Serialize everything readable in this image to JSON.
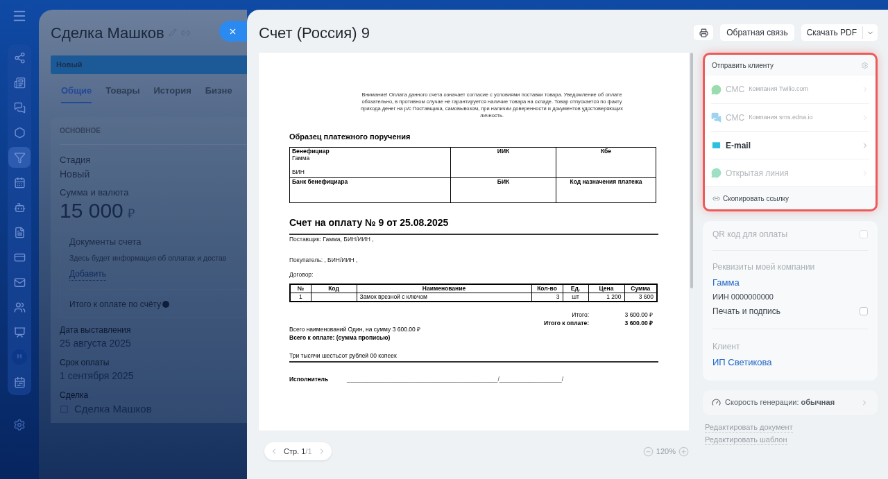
{
  "sidebar": {
    "items": [
      {
        "kind": "icon",
        "selected": false
      },
      {
        "kind": "icon",
        "selected": false
      },
      {
        "kind": "icon",
        "selected": false
      },
      {
        "kind": "icon",
        "selected": false
      },
      {
        "kind": "icon",
        "selected": true
      },
      {
        "kind": "icon",
        "selected": false
      },
      {
        "kind": "icon",
        "selected": false
      },
      {
        "kind": "icon",
        "selected": false
      },
      {
        "kind": "icon",
        "selected": false
      },
      {
        "kind": "icon",
        "selected": false
      },
      {
        "kind": "icon",
        "selected": false
      },
      {
        "kind": "icon",
        "selected": false
      },
      {
        "kind": "avatar",
        "label": "Н",
        "selected": false
      },
      {
        "kind": "icon",
        "selected": false
      }
    ]
  },
  "deal": {
    "title": "Сделка Машков",
    "stage": "Новый",
    "tabs": [
      {
        "label": "Общие",
        "selected": true
      },
      {
        "label": "Товары",
        "selected": false
      },
      {
        "label": "История",
        "selected": false
      },
      {
        "label": "Бизне",
        "selected": false
      }
    ],
    "section": "ОСНОВНОЕ",
    "stage_label": "Стадия",
    "stage_value": "Новый",
    "amount_label": "Сумма и валюта",
    "amount": "15 000",
    "currency": "₽",
    "documents": {
      "title": "Документы счета",
      "text": "Здесь будет информация об оплатах и достав",
      "add": "Добавить",
      "total": "Итого к оплате по счёту"
    },
    "fields": [
      {
        "label": "Дата выставления",
        "value": "25 августа 2025"
      },
      {
        "label": "Срок оплаты",
        "value": "1 сентября 2025"
      }
    ],
    "link_label": "Сделка",
    "link_value": "Сделка Машков"
  },
  "slider": {
    "title": "Счет (Россия) 9",
    "buttons": [
      "Обратная связь"
    ],
    "download": "Скачать PDF"
  },
  "document": {
    "notice": "Внимание! Оплата данного счета означает  согласие  с условиями  поставки товара. Уведомление об оплате обязательно,   в противном   случае не гарантируется наличие товара на складе. Товар отпускается по факту прихода денег на р/с Поставщика, самовывозом, при наличии доверенности и документов удостоверяющих личность.",
    "order_title": "Образец платежного поручения",
    "order_rows": [
      [
        {
          "head": "Бенефициар",
          "lines": [
            "Гамма",
            "БИН"
          ]
        },
        {
          "head": "ИИК"
        },
        {
          "head": "Кбе"
        }
      ],
      [
        {
          "head": "Банк бенефициара"
        },
        {
          "head": "БИК"
        },
        {
          "head": "Код назначения платежа"
        }
      ]
    ],
    "invoice_title": "Счет на оплату № 9 от 25.08.2025",
    "supplier": "Поставщик: Гамма, БИН/ИИН ,",
    "buyer": "Покупатель: , БИН/ИИН ,",
    "contract": "Договор:",
    "columns": [
      "№",
      "Код",
      "Наименование",
      "Кол-во",
      "Ед.",
      "Цена",
      "Сумма"
    ],
    "rows": [
      [
        "1",
        "",
        "Замок врезной с ключом",
        "3",
        "шт",
        "1 200",
        "3 600"
      ]
    ],
    "totals": [
      {
        "label": "Итого:",
        "value": "3 600.00 ₽",
        "bold": false
      },
      {
        "label": "Итого к оплате:",
        "value": "3 600.00 ₽",
        "bold": true
      }
    ],
    "count_line": "Всего наименований Один, на сумму 3 600.00 ₽",
    "words_title": "Всего к оплате: (сумма прописью)",
    "words": "Три тысячи шестьсот рублей 00 копеек",
    "signer": "Исполнитель",
    "sign_line": "______________________________________________/___________________/"
  },
  "pager": {
    "page": "Стр. 1",
    "total": "/1",
    "zoom": "120%"
  },
  "send_panel": {
    "title": "Отправить клиенту",
    "highlighted": true,
    "channels": [
      {
        "name": "СМС",
        "provider": "Компания Twilio.com",
        "disabled": true
      },
      {
        "name": "СМС",
        "provider": "Компания sms.edna.io",
        "disabled": true
      },
      {
        "name": "E-mail",
        "disabled": false
      },
      {
        "name": "Открытая линия",
        "disabled": true
      }
    ],
    "copy_link": "Скопировать ссылку"
  },
  "options": {
    "qr": {
      "label": "QR код для оплаты",
      "checked": false,
      "disabled": true
    },
    "company_label": "Реквизиты моей компании",
    "company": "Гамма",
    "company_id": "ИИН 0000000000",
    "stamp": {
      "label": "Печать и подпись",
      "checked": false,
      "disabled": false
    },
    "client_label": "Клиент",
    "client": "ИП Светикова"
  },
  "speed": "Скорость генерации: **обычная**",
  "edit_links": [
    "Редактировать документ",
    "Редактировать шаблон"
  ]
}
